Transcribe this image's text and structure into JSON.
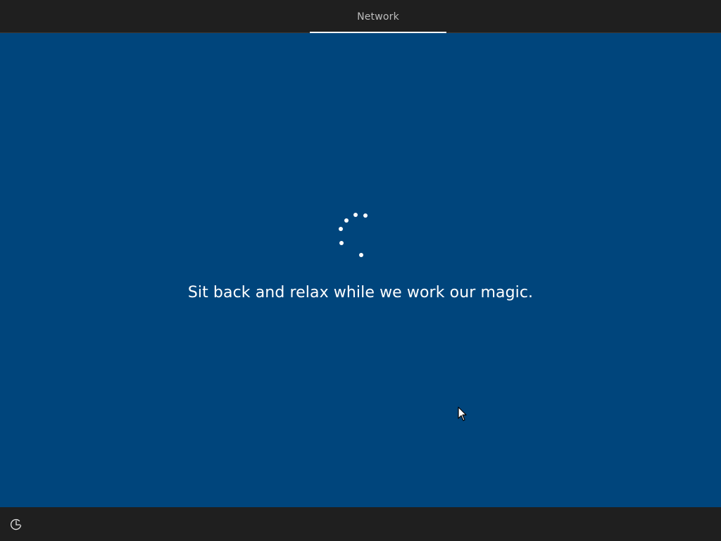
{
  "header": {
    "active_tab_label": "Network"
  },
  "main": {
    "status_message": "Sit back and relax while we work our magic.",
    "spinner_icon": "loading-dots-icon",
    "background_color": "#00457c"
  },
  "footer": {
    "accessibility_icon": "ease-of-access-icon"
  },
  "colors": {
    "bar_background": "#1f1f1f",
    "accent_underline": "#ffffff",
    "text": "#ffffff",
    "tab_text": "#bdbdbd"
  }
}
